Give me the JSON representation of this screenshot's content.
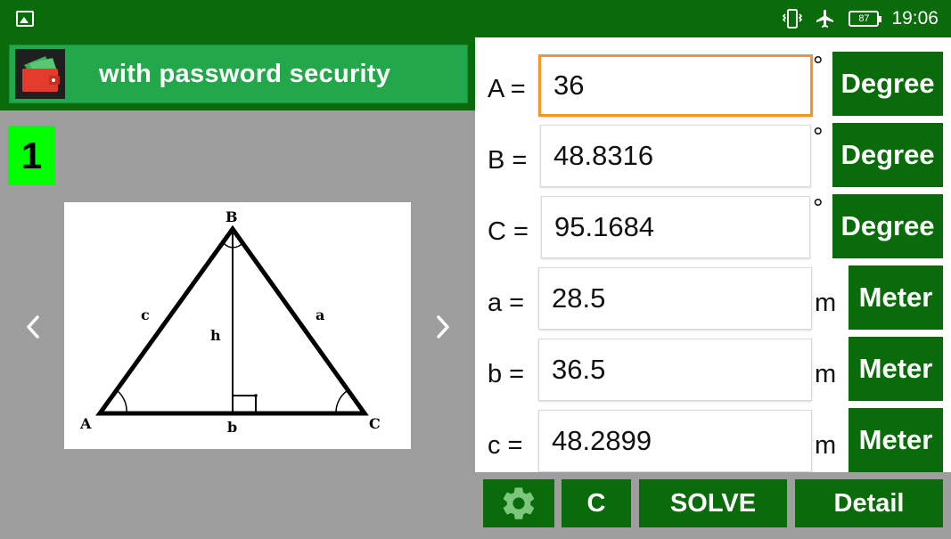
{
  "status_bar": {
    "battery": "87",
    "time": "19:06"
  },
  "banner": {
    "title": "with password security"
  },
  "diagram": {
    "page_number": "1",
    "labels": {
      "vertex_a": "A",
      "vertex_b": "B",
      "vertex_c": "C",
      "side_a": "a",
      "side_b": "b",
      "side_c": "c",
      "height": "h"
    }
  },
  "fields": [
    {
      "label": "A =",
      "value": "36",
      "unit": "°",
      "button": "Degree"
    },
    {
      "label": "B =",
      "value": "48.8316",
      "unit": "°",
      "button": "Degree"
    },
    {
      "label": "C =",
      "value": "95.1684",
      "unit": "°",
      "button": "Degree"
    },
    {
      "label": "a =",
      "value": "28.5",
      "unit": "m",
      "button": "Meter"
    },
    {
      "label": "b =",
      "value": "36.5",
      "unit": "m",
      "button": "Meter"
    },
    {
      "label": "c =",
      "value": "48.2899",
      "unit": "m",
      "button": "Meter"
    }
  ],
  "toolbar": {
    "clear_label": "C",
    "solve_label": "SOLVE",
    "detail_label": "Detail"
  },
  "icons": {
    "status_left": "image-icon",
    "vibrate": "vibrate-icon",
    "airplane": "airplane-icon",
    "wallet": "wallet-icon",
    "settings": "gear-icon",
    "prev": "chevron-left-icon",
    "next": "chevron-right-icon"
  },
  "colors": {
    "primary_dark_green": "#0a6b0a",
    "banner_green": "#22a74a",
    "page_number_green": "#00ff00",
    "focus_orange": "#f0962a",
    "background_gray": "#9e9e9e"
  }
}
